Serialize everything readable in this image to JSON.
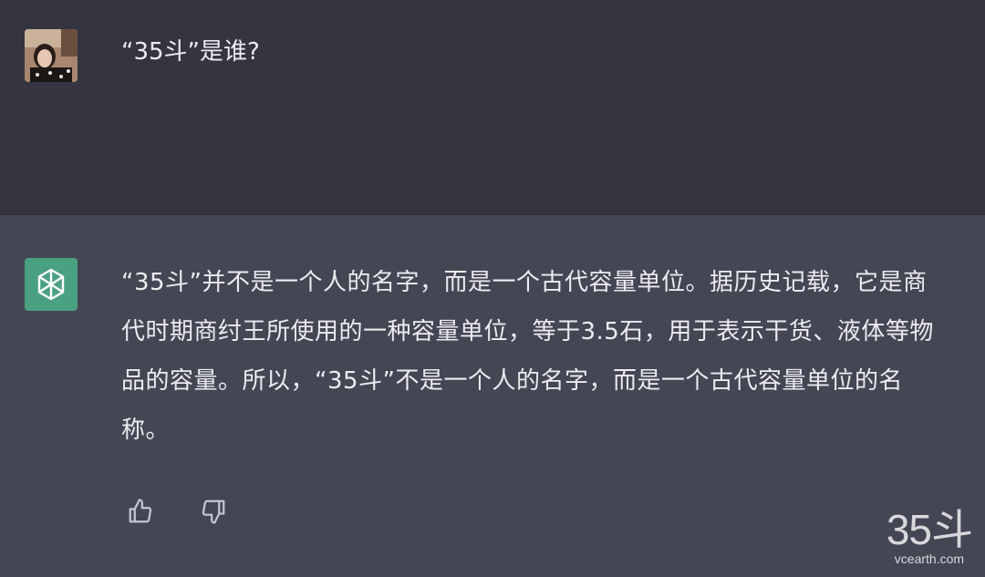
{
  "user_message": {
    "text": "“35斗”是谁?"
  },
  "assistant_message": {
    "text": "“35斗”并不是一个人的名字，而是一个古代容量单位。据历史记载，它是商代时期商纣王所使用的一种容量单位，等于3.5石，用于表示干货、液体等物品的容量。所以，“35斗”不是一个人的名字，而是一个古代容量单位的名称。"
  },
  "actions": {
    "thumbs_up_icon": "thumbs-up-icon",
    "thumbs_down_icon": "thumbs-down-icon"
  },
  "watermark": {
    "logo": "35斗",
    "url": "vcearth.com"
  },
  "colors": {
    "user_bg": "#343541",
    "assistant_bg": "#444654",
    "bot_avatar": "#4aa181",
    "text": "#ececf1"
  }
}
